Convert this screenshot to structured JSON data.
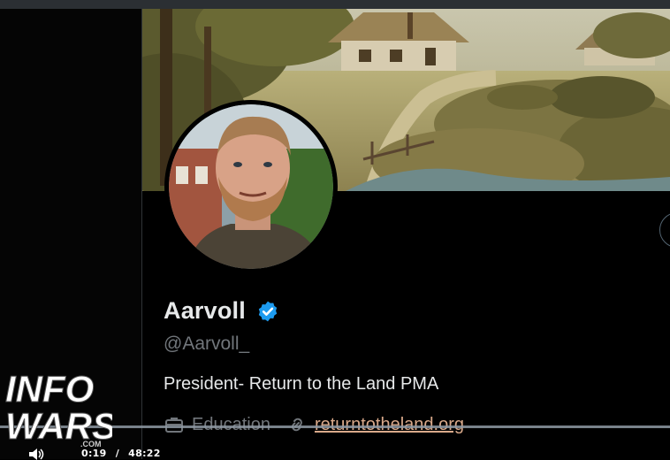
{
  "profile": {
    "display_name": "Aarvoll",
    "handle": "@Aarvoll_",
    "bio": "President- Return to the Land PMA",
    "category": "Education",
    "website": "returntotheland.org",
    "verified": true
  },
  "icons": {
    "verified": "verified-check-icon",
    "category": "briefcase-icon",
    "website": "link-icon",
    "volume": "volume-icon"
  },
  "video": {
    "current_time": "0:19",
    "separator": "/",
    "duration": "48:22"
  },
  "watermark": {
    "logo_text_line1": "INFO",
    "logo_text_line2": "WARS",
    "logo_text_small": ".COM"
  },
  "colors": {
    "background": "#000000",
    "verified_blue": "#1d9bf0",
    "muted_text": "#71767b",
    "link_color": "#d9a98a"
  }
}
